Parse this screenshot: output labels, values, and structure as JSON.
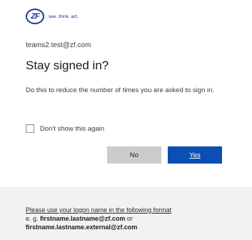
{
  "logo": {
    "mark": "ZF",
    "tagline": "see. think. act."
  },
  "account": {
    "email": "teams2.test@zf.com"
  },
  "prompt": {
    "title": "Stay signed in?",
    "description": "Do this to reduce the number of times you are asked to sign in."
  },
  "checkbox": {
    "label": "Don't show this again",
    "checked": false
  },
  "buttons": {
    "no": "No",
    "yes": "Yes"
  },
  "footer": {
    "line1": "Please use your logon name in the following format",
    "eg_prefix": "e. g.",
    "example1": "firstname.lastname@zf.com",
    "or": "or",
    "example2": "firstname.lastname.external@zf.com"
  },
  "colors": {
    "brand": "#1a3a8f",
    "primary_button": "#0b4fb3",
    "secondary_button": "#cccccc",
    "footer_bg": "#f2f2f2"
  }
}
